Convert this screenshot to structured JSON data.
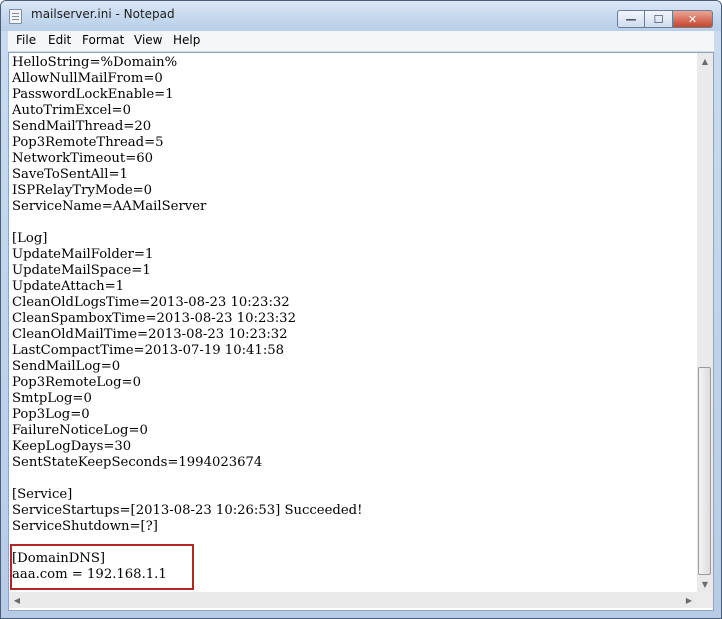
{
  "window": {
    "title": "mailserver.ini - Notepad",
    "controls": {
      "minimize": "—",
      "maximize": "☐",
      "close": "✕"
    }
  },
  "menu": [
    "File",
    "Edit",
    "Format",
    "View",
    "Help"
  ],
  "lines": [
    "HelloString=%Domain%",
    "AllowNullMailFrom=0",
    "PasswordLockEnable=1",
    "AutoTrimExcel=0",
    "SendMailThread=20",
    "Pop3RemoteThread=5",
    "NetworkTimeout=60",
    "SaveToSentAll=1",
    "ISPRelayTryMode=0",
    "ServiceName=AAMailServer",
    "",
    "[Log]",
    "UpdateMailFolder=1",
    "UpdateMailSpace=1",
    "UpdateAttach=1",
    "CleanOldLogsTime=2013-08-23 10:23:32",
    "CleanSpamboxTime=2013-08-23 10:23:32",
    "CleanOldMailTime=2013-08-23 10:23:32",
    "LastCompactTime=2013-07-19 10:41:58",
    "SendMailLog=0",
    "Pop3RemoteLog=0",
    "SmtpLog=0",
    "Pop3Log=0",
    "FailureNoticeLog=0",
    "KeepLogDays=30",
    "SentStateKeepSeconds=1994023674",
    "",
    "[Service]",
    "ServiceStartups=[2013-08-23 10:26:53] Succeeded!",
    "ServiceShutdown=[?]",
    "",
    "[DomainDNS]",
    "aaa.com = 192.168.1.1"
  ],
  "highlight": {
    "color": "#b32626",
    "first_line": 31,
    "last_line": 32
  },
  "scrollbar": {
    "vertical_position": "bottom"
  }
}
